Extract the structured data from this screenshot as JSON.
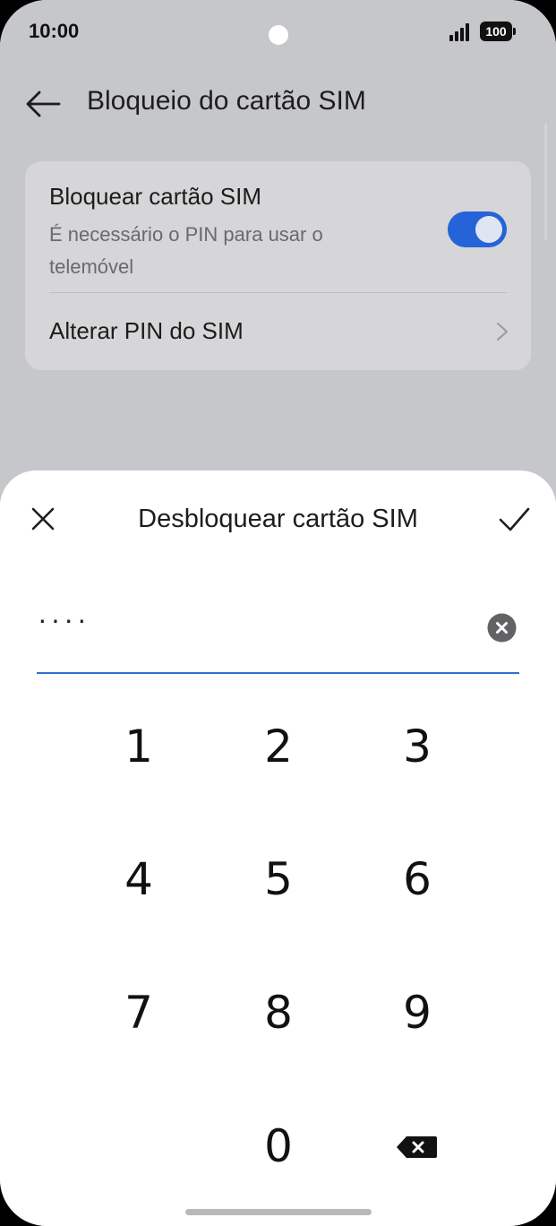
{
  "status_bar": {
    "time": "10:00",
    "battery": "100"
  },
  "header": {
    "title": "Bloqueio do cartão SIM"
  },
  "sim_lock": {
    "title": "Bloquear cartão SIM",
    "description": "É necessário o PIN para usar o telemóvel",
    "toggle_on": true,
    "change_pin_label": "Alterar PIN do SIM"
  },
  "dialog": {
    "title": "Desbloquear cartão SIM",
    "pin_masked": "····"
  },
  "keypad": {
    "k1": "1",
    "k2": "2",
    "k3": "3",
    "k4": "4",
    "k5": "5",
    "k6": "6",
    "k7": "7",
    "k8": "8",
    "k9": "9",
    "k0": "0"
  },
  "colors": {
    "accent": "#2563d8",
    "scrim": "#c6c7cb",
    "card": "#d6d6d8"
  }
}
